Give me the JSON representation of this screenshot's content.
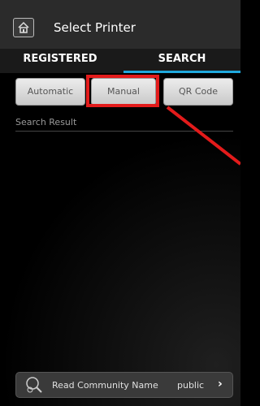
{
  "header": {
    "title": "Select Printer"
  },
  "tabs": [
    {
      "label": "REGISTERED",
      "active": false
    },
    {
      "label": "SEARCH",
      "active": true
    }
  ],
  "search_modes": [
    {
      "label": "Automatic"
    },
    {
      "label": "Manual",
      "highlighted": true
    },
    {
      "label": "QR Code"
    }
  ],
  "section": {
    "label": "Search Result"
  },
  "bottom": {
    "label": "Read Community Name",
    "value": "public",
    "chevron": "›"
  },
  "colors": {
    "accent": "#1fa8dc",
    "highlight": "#e31b1b"
  },
  "icons": {
    "home": "home-icon",
    "search_gear": "search-gear-icon",
    "chevron": "chevron-right-icon"
  }
}
